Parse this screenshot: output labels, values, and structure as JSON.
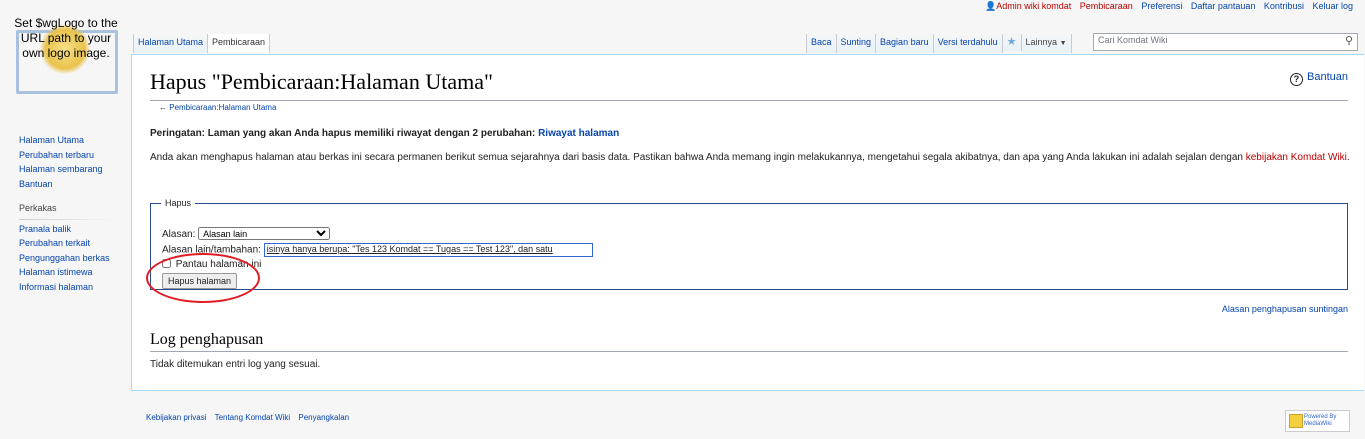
{
  "personal": {
    "user": "Admin wiki komdat",
    "talk": "Pembicaraan",
    "prefs": "Preferensi",
    "watchlist": "Daftar pantauan",
    "contribs": "Kontribusi",
    "logout": "Keluar log"
  },
  "logo": {
    "text": "Set $wgLogo to the URL path to your own logo image."
  },
  "nav": {
    "items": [
      "Halaman Utama",
      "Perubahan terbaru",
      "Halaman sembarang",
      "Bantuan"
    ]
  },
  "tools": {
    "heading": "Perkakas",
    "items": [
      "Pranala balik",
      "Perubahan terkait",
      "Pengunggahan berkas",
      "Halaman istimewa",
      "Informasi halaman"
    ]
  },
  "tabs": {
    "left": [
      "Halaman Utama",
      "Pembicaraan"
    ],
    "right": [
      "Baca",
      "Sunting",
      "Bagian baru",
      "Versi terdahulu"
    ],
    "more": "Lainnya"
  },
  "search": {
    "placeholder": "Cari Komdat Wiki"
  },
  "page": {
    "title": "Hapus \"Pembicaraan:Halaman Utama\"",
    "help": "Bantuan",
    "back_link": "Pembicaraan:Halaman Utama",
    "warning_prefix": "Peringatan: Laman yang akan Anda hapus memiliki riwayat dengan 2 perubahan: ",
    "warning_link": "Riwayat halaman",
    "para_text": "Anda akan menghapus halaman atau berkas ini secara permanen berikut semua sejarahnya dari basis data. Pastikan bahwa Anda memang ingin melakukannya, mengetahui segala akibatnya, dan apa yang Anda lakukan ini adalah sejalan dengan ",
    "para_link": "kebijakan Komdat Wiki",
    "para_end": "."
  },
  "form": {
    "legend": "Hapus",
    "reason_label": "Alasan:",
    "reason_value": "Alasan lain",
    "other_label": "Alasan lain/tambahan:",
    "other_value": "isinya hanya berupa: \"Tes 123 Komdat  == Tugas ==  Test 123\", dan satu",
    "watch_label": "Pantau halaman ini",
    "submit": "Hapus halaman"
  },
  "edit_reasons": "Alasan penghapusan suntingan",
  "log": {
    "heading": "Log penghapusan",
    "empty": "Tidak ditemukan entri log yang sesuai."
  },
  "footer": {
    "privacy": "Kebijakan privasi",
    "about": "Tentang Komdat Wiki",
    "disclaimer": "Penyangkalan",
    "powered": "Powered By MediaWiki"
  },
  "colors": {
    "link": "#0645ad",
    "redlink": "#ba0000",
    "annotation": "#e31b23"
  }
}
